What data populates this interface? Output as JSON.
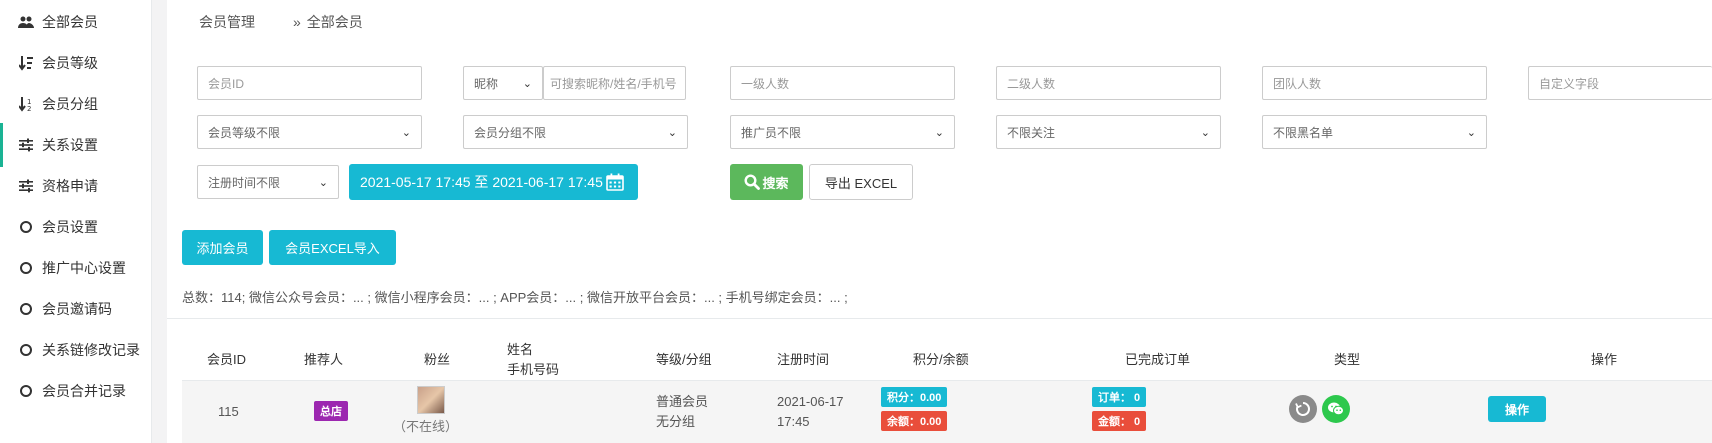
{
  "sidebar": {
    "items": [
      {
        "label": "全部会员",
        "icon": "users-icon"
      },
      {
        "label": "会员等级",
        "icon": "sort-numeric-icon"
      },
      {
        "label": "会员分组",
        "icon": "sort-numeric-desc-icon"
      },
      {
        "label": "关系设置",
        "icon": "sliders-icon"
      },
      {
        "label": "资格申请",
        "icon": "sliders-icon"
      },
      {
        "label": "会员设置",
        "icon": "circle-icon"
      },
      {
        "label": "推广中心设置",
        "icon": "circle-icon"
      },
      {
        "label": "会员邀请码",
        "icon": "circle-icon"
      },
      {
        "label": "关系链修改记录",
        "icon": "circle-icon"
      },
      {
        "label": "会员合并记录",
        "icon": "circle-icon"
      }
    ]
  },
  "breadcrumb": {
    "parent": "会员管理",
    "separator": "»",
    "current": "全部会员"
  },
  "filters": {
    "member_id_placeholder": "会员ID",
    "nickname_select": "昵称",
    "keyword_placeholder": "可搜索昵称/姓名/手机号",
    "level1_placeholder": "一级人数",
    "level2_placeholder": "二级人数",
    "team_placeholder": "团队人数",
    "custom_placeholder": "自定义字段",
    "level_select": "会员等级不限",
    "group_select": "会员分组不限",
    "promoter_select": "推广员不限",
    "follow_select": "不限关注",
    "blacklist_select": "不限黑名单",
    "regtime_select": "注册时间不限",
    "date_range": "2021-05-17 17:45 至 2021-06-17 17:45",
    "search_label": "搜索",
    "export_label": "导出 EXCEL"
  },
  "actions": {
    "add_member": "添加会员",
    "import_excel": "会员EXCEL导入"
  },
  "summary": "总数：114; 微信公众号会员：... ;   微信小程序会员：... ;   APP会员：... ;   微信开放平台会员：... ;   手机号绑定会员：... ;",
  "table": {
    "headers": {
      "member_id": "会员ID",
      "referrer": "推荐人",
      "fans": "粉丝",
      "name": "姓名",
      "phone": "手机号码",
      "level_group": "等级/分组",
      "reg_time": "注册时间",
      "points_balance": "积分/余额",
      "orders": "已完成订单",
      "type": "类型",
      "ops": "操作"
    },
    "rows": [
      {
        "member_id": "115",
        "referrer": "总店",
        "fans_status": "（不在线）",
        "level": "普通会员",
        "group": "无分组",
        "reg_date": "2021-06-17",
        "reg_clock": "17:45",
        "points": "积分：0.00",
        "balance": "余额：0.00",
        "orders": "订单： 0",
        "amount": "金额： 0",
        "ops_label": "操作"
      }
    ]
  },
  "colors": {
    "accent": "#17b9d3",
    "green": "#5cb85c",
    "purple": "#9c27b0",
    "red": "#e94e3b"
  }
}
